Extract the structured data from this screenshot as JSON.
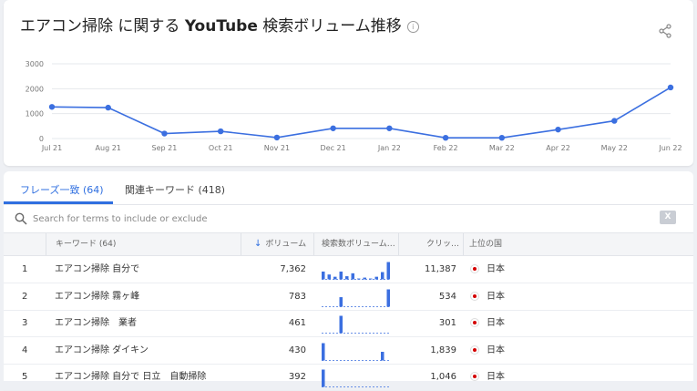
{
  "header": {
    "title_prefix": "エアコン掃除 に関する ",
    "title_brand": "YouTube",
    "title_suffix": " 検索ボリューム推移",
    "info_symbol": "i"
  },
  "chart_data": {
    "type": "line",
    "title": "エアコン掃除 に関する YouTube 検索ボリューム推移",
    "categories": [
      "Jul 21",
      "Aug 21",
      "Sep 21",
      "Oct 21",
      "Nov 21",
      "Dec 21",
      "Jan 22",
      "Feb 22",
      "Mar 22",
      "Apr 22",
      "May 22",
      "Jun 22"
    ],
    "values": [
      1270,
      1240,
      200,
      290,
      40,
      410,
      410,
      30,
      30,
      360,
      710,
      2050
    ],
    "yticks": [
      0,
      1000,
      2000,
      3000
    ],
    "ylim": [
      0,
      3000
    ],
    "grid": true,
    "color": "#3b6fe0"
  },
  "tabs": [
    {
      "label": "フレーズ一致",
      "count": "(64)"
    },
    {
      "label": "関連キーワード (418)"
    }
  ],
  "search": {
    "placeholder": "Search for terms to include or exclude"
  },
  "export": {
    "label": "X"
  },
  "table": {
    "headers": {
      "keyword": "キーワード (64)",
      "volume": "ボリューム",
      "trend": "検索数ボリューム…",
      "clicks": "クリッ…",
      "country": "上位の国"
    },
    "rows": [
      {
        "rank": "1",
        "keyword": "エアコン掃除 自分で",
        "volume": "7,362",
        "clicks": "11,387",
        "country": "日本",
        "trend": [
          0.45,
          0.28,
          0.15,
          0.45,
          0.18,
          0.35,
          0.05,
          0.1,
          0.05,
          0.15,
          0.42,
          1.0
        ]
      },
      {
        "rank": "2",
        "keyword": "エアコン掃除 霧ヶ峰",
        "volume": "783",
        "clicks": "534",
        "country": "日本",
        "trend": [
          0,
          0,
          0,
          0.55,
          0,
          0,
          0,
          0,
          0,
          0,
          0,
          1.0
        ]
      },
      {
        "rank": "3",
        "keyword": "エアコン掃除　業者",
        "volume": "461",
        "clicks": "301",
        "country": "日本",
        "trend": [
          0,
          0,
          0,
          1.0,
          0,
          0,
          0,
          0,
          0,
          0,
          0,
          0
        ]
      },
      {
        "rank": "4",
        "keyword": "エアコン掃除 ダイキン",
        "volume": "430",
        "clicks": "1,839",
        "country": "日本",
        "trend": [
          1.0,
          0,
          0,
          0,
          0,
          0,
          0,
          0,
          0,
          0,
          0.5,
          0
        ]
      },
      {
        "rank": "5",
        "keyword": "エアコン掃除 自分で 日立　自動掃除",
        "volume": "392",
        "clicks": "1,046",
        "country": "日本",
        "trend": [
          1.0,
          0,
          0,
          0,
          0,
          0,
          0,
          0,
          0,
          0,
          0,
          0
        ]
      }
    ]
  }
}
